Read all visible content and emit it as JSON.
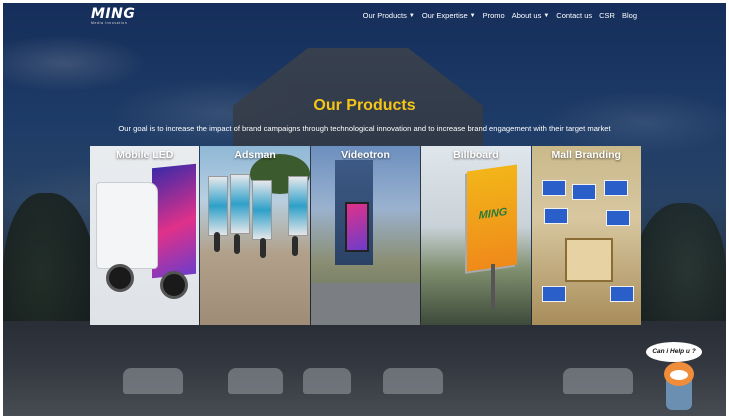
{
  "brand": {
    "logo_text": "MING",
    "logo_subtext": "Media Innovation"
  },
  "nav": [
    {
      "label": "Our Products",
      "has_dropdown": true
    },
    {
      "label": "Our Expertise",
      "has_dropdown": true
    },
    {
      "label": "Promo",
      "has_dropdown": false
    },
    {
      "label": "About us",
      "has_dropdown": true
    },
    {
      "label": "Contact us",
      "has_dropdown": false
    },
    {
      "label": "CSR",
      "has_dropdown": false
    },
    {
      "label": "Blog",
      "has_dropdown": false
    }
  ],
  "section": {
    "title": "Our Products",
    "tagline": "Our goal is to increase the impact of brand campaigns through technological innovation and to increase brand engagement with their target market"
  },
  "products": [
    {
      "label": "Mobile LED"
    },
    {
      "label": "Adsman"
    },
    {
      "label": "Videotron"
    },
    {
      "label": "Billboard"
    },
    {
      "label": "Mall Branding"
    }
  ],
  "billboard_text": "MING",
  "chat_widget": {
    "bubble": "Can i Help u ?"
  },
  "colors": {
    "title": "#f5c518",
    "nav_text": "#ffffff"
  }
}
